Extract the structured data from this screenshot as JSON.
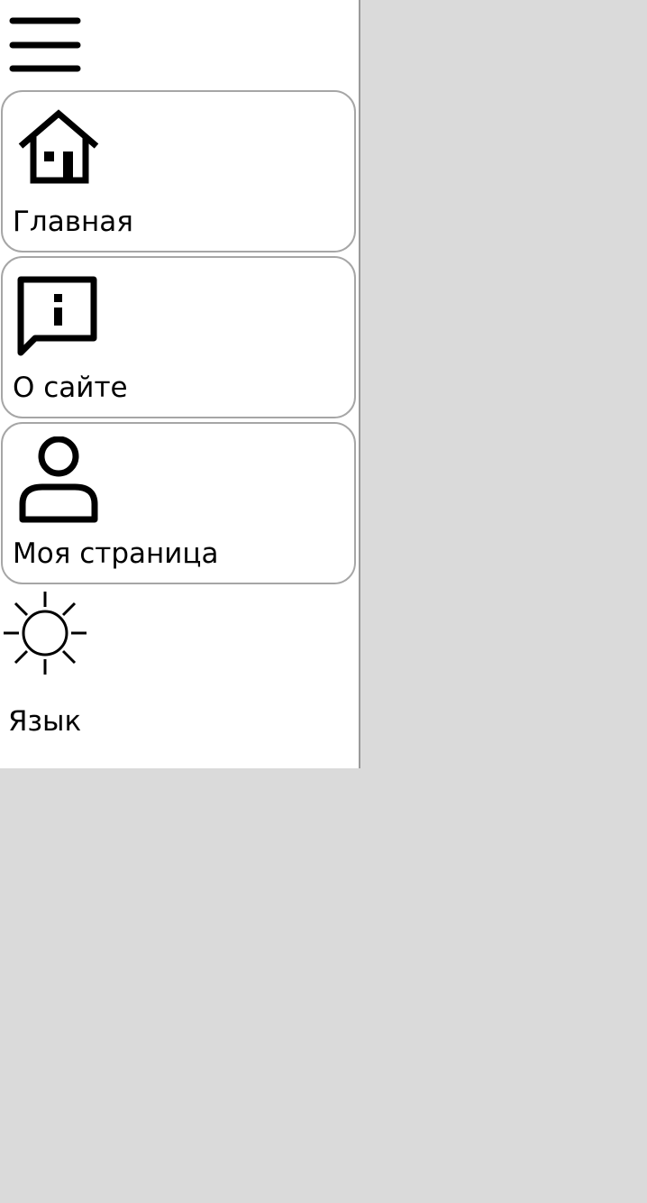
{
  "sidebar": {
    "menu_icon": "hamburger-menu-icon",
    "items": [
      {
        "label": "Главная",
        "icon": "home-icon"
      },
      {
        "label": "О сайте",
        "icon": "info-message-icon"
      },
      {
        "label": "Моя страница",
        "icon": "user-icon"
      }
    ],
    "language": {
      "label": "Язык",
      "icon": "sun-icon"
    }
  },
  "colors": {
    "background": "#dadada",
    "sidebar": "#ffffff",
    "card_border": "#a6a6a6",
    "divider": "#9a9a9a",
    "text": "#000000"
  }
}
